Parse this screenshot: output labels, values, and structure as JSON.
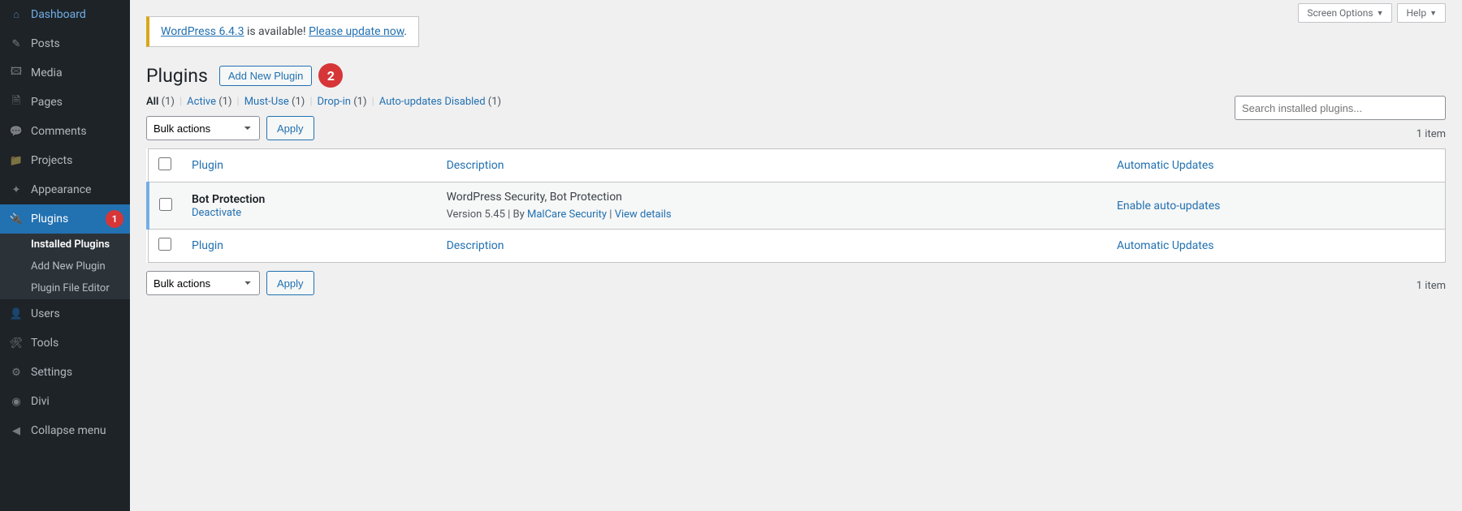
{
  "sidebar": {
    "items": [
      {
        "label": "Dashboard",
        "icon": "⌂"
      },
      {
        "label": "Posts",
        "icon": "✎"
      },
      {
        "label": "Media",
        "icon": "🖾"
      },
      {
        "label": "Pages",
        "icon": "🗎"
      },
      {
        "label": "Comments",
        "icon": "💬"
      },
      {
        "label": "Projects",
        "icon": "📁"
      },
      {
        "label": "Appearance",
        "icon": "✦"
      },
      {
        "label": "Plugins",
        "icon": "🔌",
        "badge": "1"
      },
      {
        "label": "Users",
        "icon": "👤"
      },
      {
        "label": "Tools",
        "icon": "🛠"
      },
      {
        "label": "Settings",
        "icon": "⚙"
      },
      {
        "label": "Divi",
        "icon": "◉"
      },
      {
        "label": "Collapse menu",
        "icon": "◀"
      }
    ],
    "submenu": [
      {
        "label": "Installed Plugins"
      },
      {
        "label": "Add New Plugin"
      },
      {
        "label": "Plugin File Editor"
      }
    ]
  },
  "top_tabs": {
    "screen_options": "Screen Options",
    "help": "Help"
  },
  "notice": {
    "link1": "WordPress 6.4.3",
    "mid": " is available! ",
    "link2": "Please update now",
    "end": "."
  },
  "heading": {
    "title": "Plugins",
    "add_new": "Add New Plugin",
    "marker": "2"
  },
  "filters": [
    {
      "label": "All",
      "count": "(1)"
    },
    {
      "label": "Active",
      "count": "(1)"
    },
    {
      "label": "Must-Use",
      "count": "(1)"
    },
    {
      "label": "Drop-in",
      "count": "(1)"
    },
    {
      "label": "Auto-updates Disabled",
      "count": "(1)"
    }
  ],
  "bulk": {
    "placeholder": "Bulk actions",
    "apply": "Apply"
  },
  "search": {
    "placeholder": "Search installed plugins..."
  },
  "pagination": {
    "count": "1 item"
  },
  "table": {
    "columns": {
      "plugin": "Plugin",
      "description": "Description",
      "auto_updates": "Automatic Updates"
    },
    "row": {
      "name": "Bot Protection",
      "deactivate": "Deactivate",
      "desc": "WordPress Security, Bot Protection",
      "version_prefix": "Version 5.45 | By ",
      "author": "MalCare Security",
      "sep": " | ",
      "view": "View details",
      "enable": "Enable auto-updates"
    }
  }
}
